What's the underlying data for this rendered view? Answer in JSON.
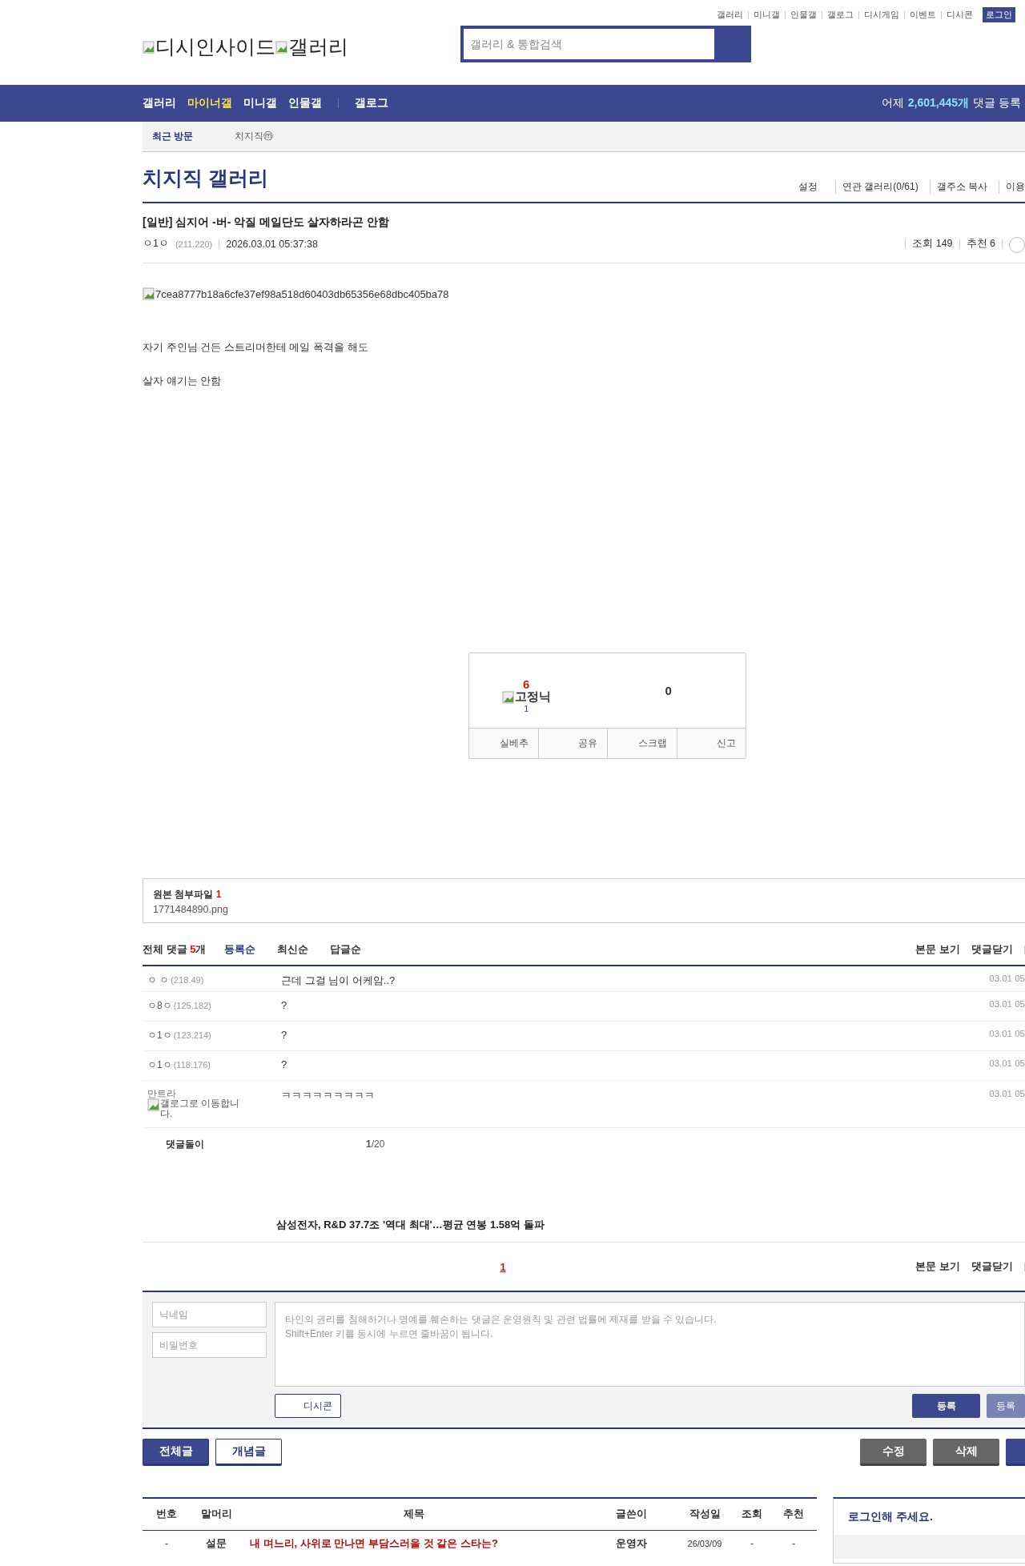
{
  "top_links": [
    "갤러리",
    "미니갤",
    "인물갤",
    "갤로그",
    "디시게임",
    "이벤트",
    "디시콘"
  ],
  "login_button": "로그인",
  "logo": {
    "site": "디시인사이드",
    "section": "갤러리"
  },
  "search": {
    "placeholder": "갤러리 & 통합검색"
  },
  "nav": {
    "items": [
      {
        "label": "갤러리",
        "selected": false
      },
      {
        "label": "마이너갤",
        "selected": true
      },
      {
        "label": "미니갤",
        "selected": false
      },
      {
        "label": "인물갤",
        "selected": false
      }
    ],
    "extra": "갤로그",
    "stats": {
      "prefix": "어제",
      "count": "2,601,445개",
      "suffix": "댓글 등록"
    }
  },
  "recent": {
    "label": "최근 방문",
    "items": [
      "치지직ⓜ"
    ]
  },
  "gallery": {
    "title": "치지직 갤러리",
    "links": [
      "설정",
      "연관 갤러리(0/61)",
      "갤주소 복사",
      "이용"
    ]
  },
  "post": {
    "title": "[일반] 심지어 -버- 악질 메일단도 살자하라곤 안함",
    "author": "ㅇ1ㅇ",
    "ip": "(211.220)",
    "date": "2026.03.01 05:37:38",
    "views": "조회 149",
    "recommends": "추천 6",
    "image_alt": "7cea8777b18a6cfe37ef98a518d60403db65356e68dbc405ba78",
    "paragraphs": [
      "자기 주인님 건든 스트리머한테 메일 폭격을 해도",
      "살자 얘기는 안함"
    ]
  },
  "vote": {
    "up": "6",
    "up_label": "고정닉",
    "up_sub": "1",
    "down": "0",
    "actions": [
      "실베추",
      "공유",
      "스크랩",
      "신고"
    ]
  },
  "attachment": {
    "label": "원본 첨부파일",
    "count": "1",
    "file": "1771484890.png"
  },
  "comments": {
    "label": "전체 댓글",
    "count": "5",
    "unit": "개",
    "sorts": [
      {
        "label": "등록순",
        "selected": true
      },
      {
        "label": "최신순",
        "selected": false
      },
      {
        "label": "답글순",
        "selected": false
      }
    ],
    "links": [
      "본문 보기",
      "댓글닫기"
    ],
    "items": [
      {
        "kind": "ip",
        "nick": "ㅇ ㅇ",
        "ip": "(218.49)",
        "text": "근데 그걸 님이 어케암..?",
        "date": "03.01 05"
      },
      {
        "kind": "ip",
        "nick": "ㅇ8ㅇ",
        "ip": "(125.182)",
        "text": "?",
        "date": "03.01 05"
      },
      {
        "kind": "ip",
        "nick": "ㅇ1ㅇ",
        "ip": "(123.214)",
        "text": "?",
        "date": "03.01 05"
      },
      {
        "kind": "ip",
        "nick": "ㅇ1ㅇ",
        "ip": "(118.176)",
        "text": "?",
        "date": "03.01 05"
      },
      {
        "kind": "gallog",
        "nick": "만트라",
        "badge_alt": "갤로그로 이동합니다.",
        "text": "ㅋㅋㅋㅋㅋㅋㅋㅋㅋ",
        "date": "03.01 05"
      }
    ],
    "bot": {
      "label": "댓글돌이",
      "page": "1",
      "total": "/20",
      "headline": "삼성전자, R&D 37.7조 '역대 최대'…평균 연봉 1.58억 돌파"
    },
    "pagination": [
      {
        "label": "1",
        "selected": true
      }
    ],
    "links_bottom": [
      "본문 보기",
      "댓글닫기"
    ]
  },
  "form": {
    "nick_placeholder": "닉네임",
    "password_placeholder": "비밀번호",
    "text_placeholder": "타인의 권리를 침해하거나 명예를 훼손하는 댓글은 운영원칙 및 관련 법률에 제재를 받을 수 있습니다.\nShift+Enter 키를 동시에 누르면 줄바꿈이 됩니다.",
    "dccon": "디시콘",
    "submit": "등록",
    "submit_alt": "등록"
  },
  "buttons": {
    "left": [
      {
        "label": "전체글",
        "selected": true
      },
      {
        "label": "개념글",
        "selected": false
      }
    ],
    "right": [
      "수정",
      "삭제"
    ]
  },
  "list": {
    "columns": [
      "번호",
      "말머리",
      "제목",
      "글쓴이",
      "작성일",
      "조회",
      "추천"
    ],
    "rows": [
      {
        "cells": [
          "-",
          "설문",
          "내 며느리, 사위로 만나면 부담스러울 것 같은 스타는?",
          "운영자",
          "26/03/09",
          "-",
          "-"
        ]
      }
    ]
  },
  "login_box": {
    "title": "로그인해 주세요."
  }
}
